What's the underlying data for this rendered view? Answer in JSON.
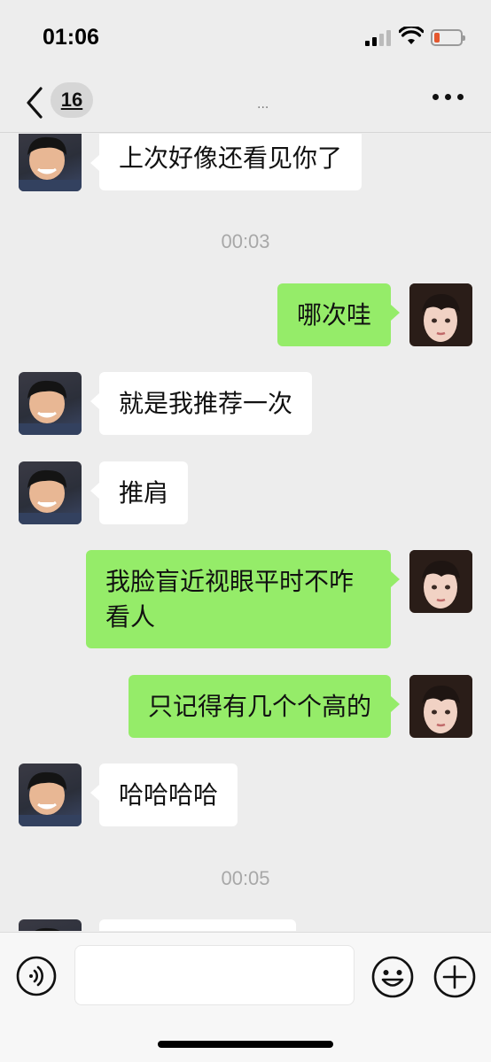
{
  "status_bar": {
    "time": "01:06"
  },
  "nav": {
    "unread_count": "16",
    "title": "..."
  },
  "messages": [
    {
      "side": "left",
      "text": "上次好像还看见你了"
    },
    {
      "timestamp": "00:03"
    },
    {
      "side": "right",
      "text": "哪次哇"
    },
    {
      "side": "left",
      "text": "就是我推荐一次"
    },
    {
      "side": "left",
      "text": "推肩"
    },
    {
      "side": "right",
      "text": "我脸盲近视眼平时不咋看人"
    },
    {
      "side": "right",
      "text": "只记得有几个个高的"
    },
    {
      "side": "left",
      "text": "哈哈哈哈"
    },
    {
      "timestamp": "00:05"
    },
    {
      "side": "left",
      "text": ""
    }
  ],
  "input": {
    "placeholder": ""
  },
  "colors": {
    "background": "#ededed",
    "sent_bubble": "#95ec69",
    "received_bubble": "#ffffff",
    "battery_low": "#e4572e"
  },
  "icons": [
    "back-icon",
    "more-icon",
    "voice-icon",
    "emoji-icon",
    "plus-icon",
    "signal-icon",
    "wifi-icon",
    "battery-icon"
  ]
}
